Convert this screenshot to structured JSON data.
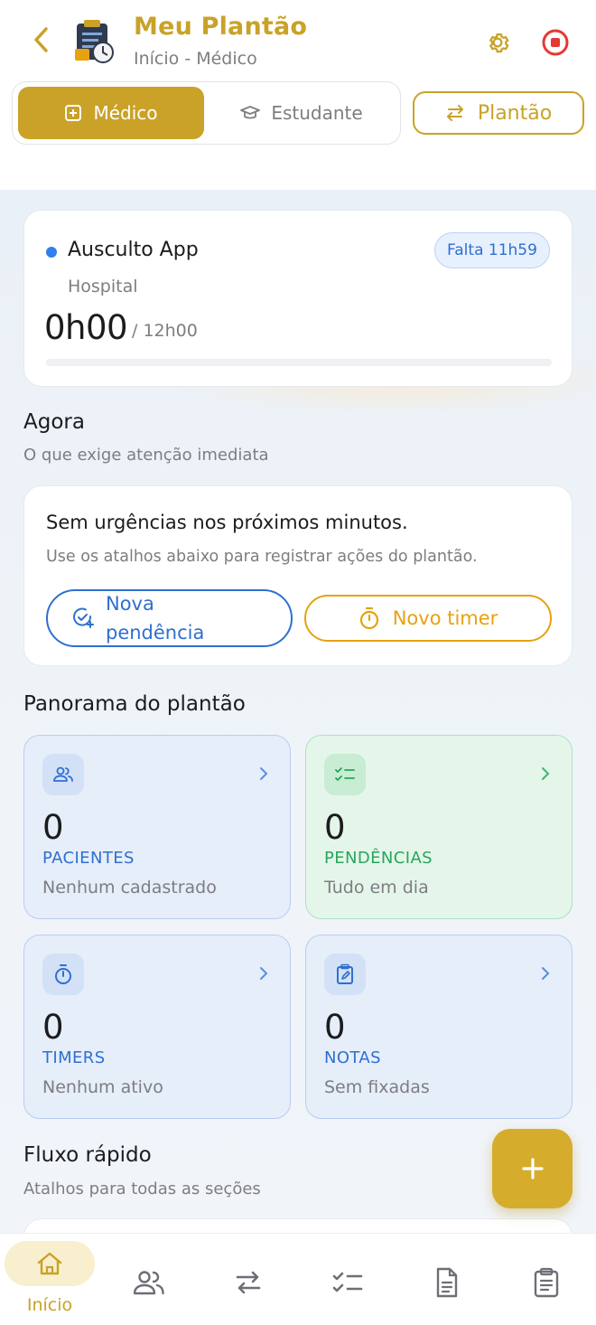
{
  "header": {
    "title": "Meu Plantão",
    "subtitle": "Início - Médico",
    "back_icon": "chevron-left-icon",
    "app_icon": "clipboard-clock-icon",
    "settings_icon": "gear-icon",
    "stop_icon": "stop-circle-icon"
  },
  "segment": {
    "options": [
      {
        "label": "Médico",
        "icon": "plus-square-icon",
        "selected": true
      },
      {
        "label": "Estudante",
        "icon": "graduation-cap-icon",
        "selected": false
      }
    ],
    "switch_label": "Plantão",
    "switch_icon": "swap-arrows-icon"
  },
  "shift": {
    "name": "Ausculto App",
    "place": "Hospital",
    "remaining": "Falta 11h59",
    "elapsed": "0h00",
    "total": "/ 12h00",
    "progress": 0.0
  },
  "now": {
    "title": "Agora",
    "subtitle": "O que exige atenção imediata",
    "message": "Sem urgências nos próximos minutos.",
    "hint": "Use os atalhos abaixo para registrar ações do plantão.",
    "btn_pendencia": "Nova pendência",
    "btn_timer": "Novo timer"
  },
  "panorama": {
    "title": "Panorama do plantão",
    "stats": [
      {
        "count": "0",
        "label": "PACIENTES",
        "sub": "Nenhum cadastrado",
        "icon": "users-icon",
        "color": "blue"
      },
      {
        "count": "0",
        "label": "PENDÊNCIAS",
        "sub": "Tudo em dia",
        "icon": "checklist-icon",
        "color": "green"
      },
      {
        "count": "0",
        "label": "TIMERS",
        "sub": "Nenhum ativo",
        "icon": "stopwatch-icon",
        "color": "blue"
      },
      {
        "count": "0",
        "label": "NOTAS",
        "sub": "Sem fixadas",
        "icon": "edit-note-icon",
        "color": "blue"
      }
    ]
  },
  "fluxo": {
    "title": "Fluxo rápido",
    "subtitle": "Atalhos para todas as seções"
  },
  "fab_icon": "plus-icon",
  "nav": {
    "home_label": "Início",
    "items": [
      "home-icon",
      "users-icon",
      "swap-arrows-icon",
      "checklist-icon",
      "document-icon",
      "clipboard-icon"
    ]
  },
  "colors": {
    "accent": "#c9a227",
    "blue": "#2f6fd1",
    "green": "#27a65a",
    "orange": "#e6a20f",
    "danger": "#e53935"
  }
}
